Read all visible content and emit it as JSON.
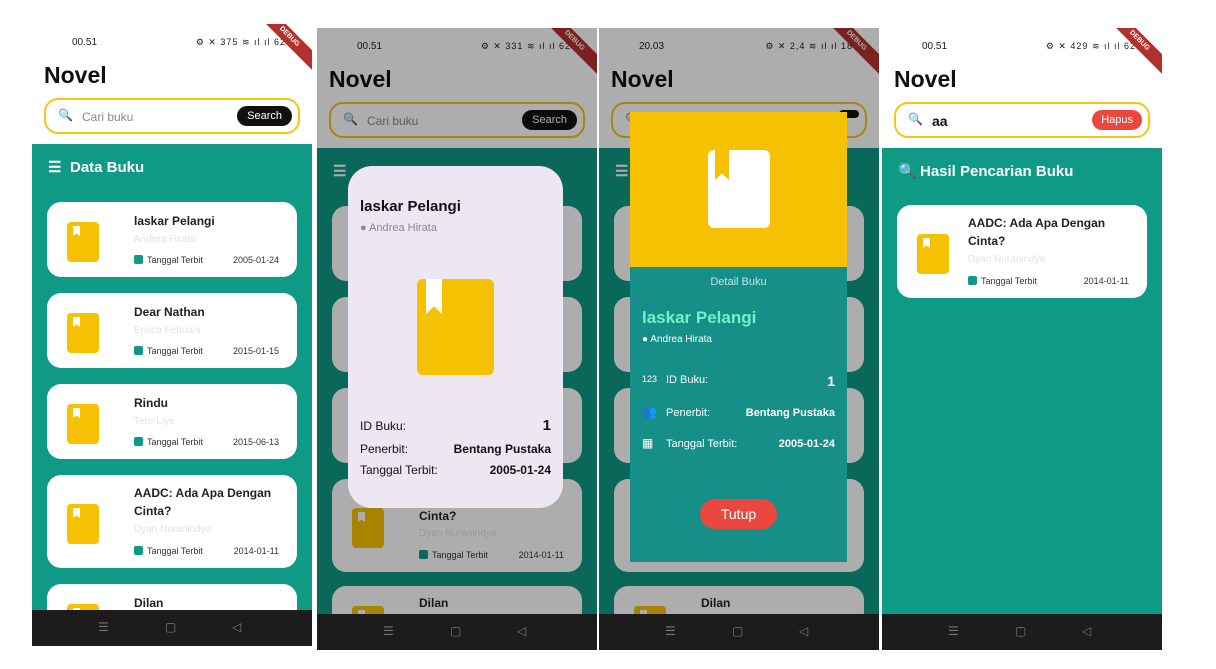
{
  "app": {
    "title": "Novel",
    "debug": "DEBUG",
    "section": "Data Buku",
    "result_section": "Hasil Pencarian Buku"
  },
  "status": [
    {
      "time": "00.51",
      "icons": "⚙ ✕ 375 ≋ ıl ıl 62"
    },
    {
      "time": "00.51",
      "icons": "⚙ ✕ 331 ≋ ıl ıl 62"
    },
    {
      "time": "20.03",
      "icons": "⚙ ✕ 2,4 ≋ ıl ıl 18"
    },
    {
      "time": "00.51",
      "icons": "⚙ ✕ 429 ≋ ıl ıl 62"
    }
  ],
  "search": {
    "placeholder": "Cari buku",
    "button": "Search",
    "query": "aa",
    "clear": "Hapus"
  },
  "date_label": "Tanggal Terbit",
  "books": [
    {
      "title": "laskar Pelangi",
      "author": "Andrea Hirata",
      "date": "2005-01-24"
    },
    {
      "title": "Dear Nathan",
      "author": "Erisca Febriani",
      "date": "2015-01-15"
    },
    {
      "title": "Rindu",
      "author": "Tere Liye",
      "date": "2015-06-13"
    },
    {
      "title": "AADC: Ada Apa Dengan Cinta?",
      "author": "Dyan Nuranindya",
      "date": "2014-01-11"
    },
    {
      "title": "Dilan",
      "author": "",
      "date": ""
    }
  ],
  "bg_cards": {
    "title": "Cinta?",
    "author": "Dyan Nuranindya",
    "date": "2014-01-11",
    "next": "Dilan"
  },
  "dialog": {
    "title": "laskar Pelangi",
    "author": "Andrea Hirata",
    "id_label": "ID Buku:",
    "id": "1",
    "publisher_label": "Penerbit:",
    "publisher": "Bentang Pustaka",
    "date_label": "Tanggal Terbit:",
    "date": "2005-01-24"
  },
  "detail": {
    "header": "Detail Buku",
    "title": "laskar Pelangi",
    "author": "Andrea Hirata",
    "id_label": "ID Buku:",
    "id": "1",
    "publisher_label": "Penerbit:",
    "publisher": "Bentang Pustaka",
    "date_label": "Tanggal Terbit:",
    "date": "2005-01-24",
    "close": "Tutup"
  },
  "result": {
    "title": "AADC: Ada Apa Dengan Cinta?",
    "author": "Dyan Nuranindya",
    "date": "2014-01-11"
  },
  "nav": {
    "menu": "☰",
    "home": "▢",
    "back": "◁"
  }
}
